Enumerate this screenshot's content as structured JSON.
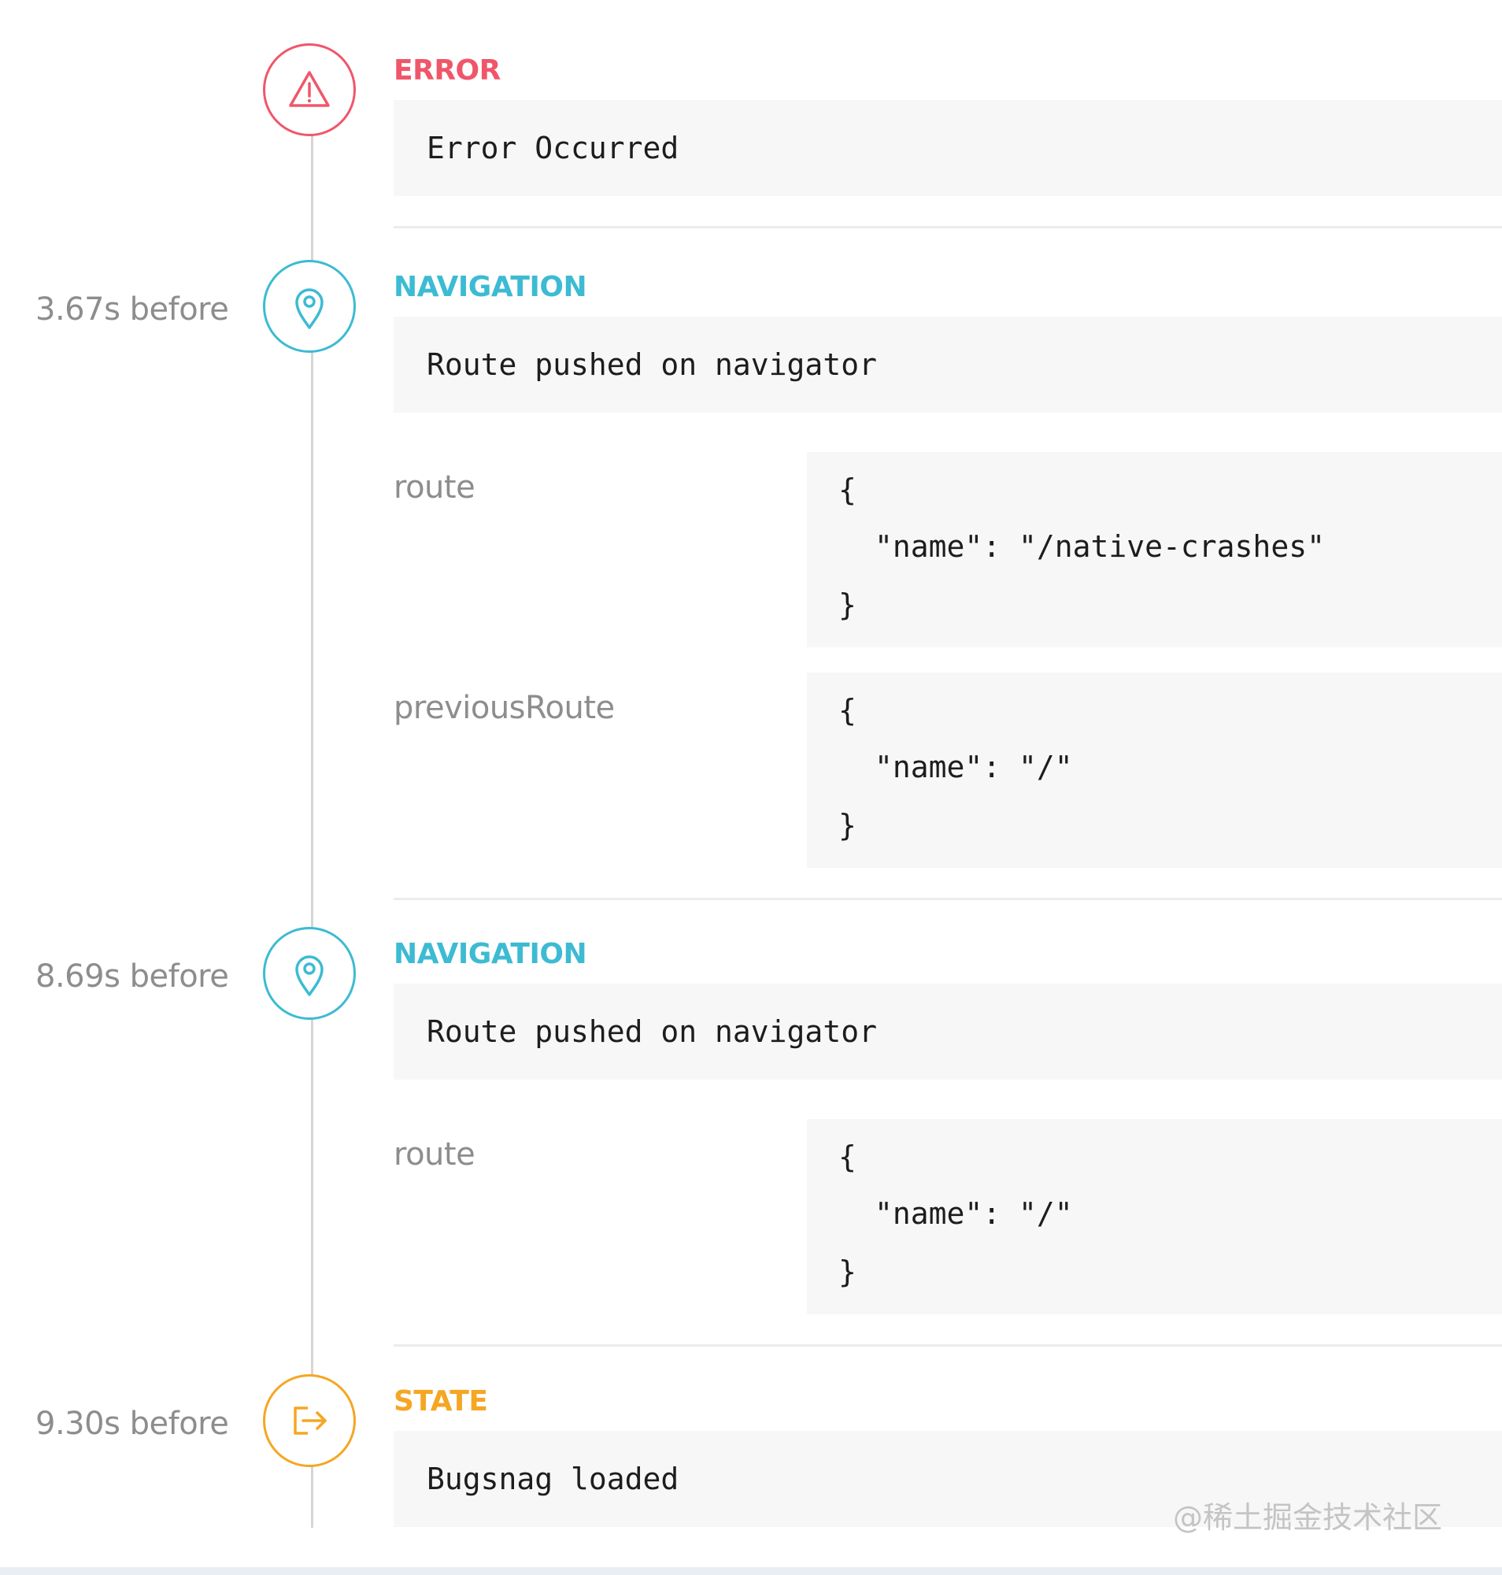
{
  "events": [
    {
      "type": "ERROR",
      "time": "",
      "icon": "warning-triangle-icon",
      "color": "#f0566a",
      "message": "Error Occurred",
      "metadata": []
    },
    {
      "type": "NAVIGATION",
      "time": "3.67s before",
      "icon": "map-pin-icon",
      "color": "#3cbbd3",
      "message": "Route pushed on navigator",
      "metadata": [
        {
          "key": "route",
          "open": "{",
          "entry": "\"name\": \"/native-crashes\"",
          "close": "}"
        },
        {
          "key": "previousRoute",
          "open": "{",
          "entry": "\"name\": \"/\"",
          "close": "}"
        }
      ]
    },
    {
      "type": "NAVIGATION",
      "time": "8.69s before",
      "icon": "map-pin-icon",
      "color": "#3cbbd3",
      "message": "Route pushed on navigator",
      "metadata": [
        {
          "key": "route",
          "open": "{",
          "entry": "\"name\": \"/\"",
          "close": "}"
        }
      ]
    },
    {
      "type": "STATE",
      "time": "9.30s before",
      "icon": "sign-out-icon",
      "color": "#f5a623",
      "message": "Bugsnag loaded",
      "metadata": []
    }
  ],
  "watermark": "@稀土掘金技术社区"
}
